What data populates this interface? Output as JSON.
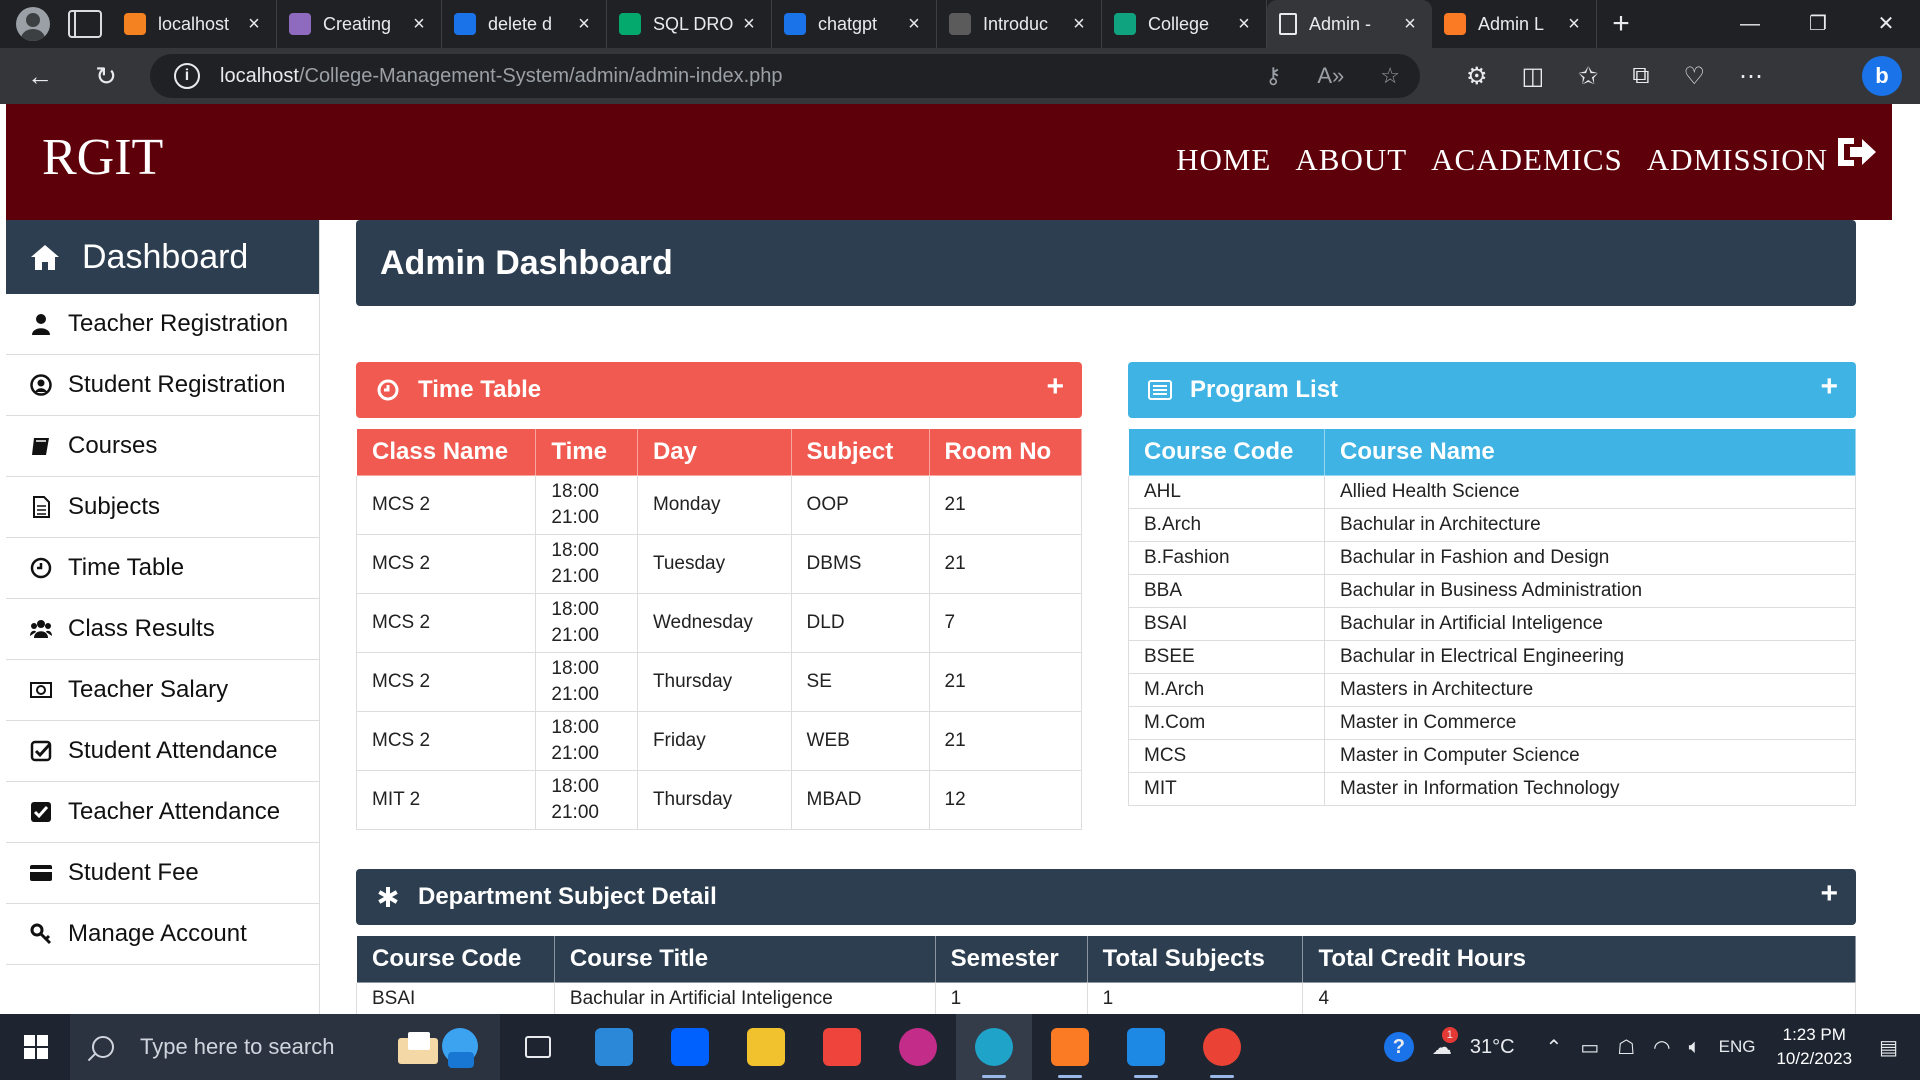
{
  "browser": {
    "tabs": [
      {
        "label": "localhost",
        "favicon": "xampp-icon",
        "color": "#f58220"
      },
      {
        "label": "Creating",
        "favicon": "avatar-icon",
        "color": "#8e6bbf"
      },
      {
        "label": "delete d",
        "favicon": "search-icon",
        "color": "#1a73e8"
      },
      {
        "label": "SQL DRO",
        "favicon": "w3schools-icon",
        "color": "#04aa6d"
      },
      {
        "label": "chatgpt",
        "favicon": "search-icon",
        "color": "#1a73e8"
      },
      {
        "label": "Introduc",
        "favicon": "openai-icon",
        "color": "#5b5b5b"
      },
      {
        "label": "College",
        "favicon": "openai-icon",
        "color": "#10a37f"
      },
      {
        "label": "Admin -",
        "favicon": "page-icon",
        "color": "#ffffff",
        "active": true
      },
      {
        "label": "Admin L",
        "favicon": "xampp-icon",
        "color": "#fb7a24"
      }
    ],
    "url_host": "localhost",
    "url_path": "/College-Management-System/admin/admin-index.php",
    "new_tab": "+",
    "window_controls": [
      "—",
      "❐",
      "✕"
    ],
    "bing_label": "b"
  },
  "site": {
    "logo": "RGIT",
    "nav": [
      "HOME",
      "ABOUT",
      "ACADEMICS",
      "ADMISSION"
    ],
    "brand_color": "#5e000a"
  },
  "sidebar": {
    "dashboard": "Dashboard",
    "items": [
      {
        "label": "Teacher Registration",
        "icon": "user-icon"
      },
      {
        "label": "Student Registration",
        "icon": "user-circle-icon"
      },
      {
        "label": "Courses",
        "icon": "book-icon"
      },
      {
        "label": "Subjects",
        "icon": "document-icon"
      },
      {
        "label": "Time Table",
        "icon": "clock-icon"
      },
      {
        "label": "Class Results",
        "icon": "users-icon"
      },
      {
        "label": "Teacher Salary",
        "icon": "money-icon"
      },
      {
        "label": "Student Attendance",
        "icon": "check-square-icon"
      },
      {
        "label": "Teacher Attendance",
        "icon": "check-square-filled-icon"
      },
      {
        "label": "Student Fee",
        "icon": "credit-card-icon"
      },
      {
        "label": "Manage Account",
        "icon": "key-icon"
      }
    ]
  },
  "main": {
    "title": "Admin Dashboard",
    "timetable": {
      "title": "Time Table",
      "color": "#f05a50",
      "headers": [
        "Class Name",
        "Time",
        "Day",
        "Subject",
        "Room No"
      ],
      "rows": [
        [
          "MCS 2",
          "18:00",
          "21:00",
          "Monday",
          "OOP",
          "21"
        ],
        [
          "MCS 2",
          "18:00",
          "21:00",
          "Tuesday",
          "DBMS",
          "21"
        ],
        [
          "MCS 2",
          "18:00",
          "21:00",
          "Wednesday",
          "DLD",
          "7"
        ],
        [
          "MCS 2",
          "18:00",
          "21:00",
          "Thursday",
          "SE",
          "21"
        ],
        [
          "MCS 2",
          "18:00",
          "21:00",
          "Friday",
          "WEB",
          "21"
        ],
        [
          "MIT 2",
          "18:00",
          "21:00",
          "Thursday",
          "MBAD",
          "12"
        ]
      ]
    },
    "programs": {
      "title": "Program List",
      "color": "#3fb3e3",
      "headers": [
        "Course Code",
        "Course Name"
      ],
      "rows": [
        [
          "AHL",
          "Allied Health Science"
        ],
        [
          "B.Arch",
          "Bachular in Architecture"
        ],
        [
          "B.Fashion",
          "Bachular in Fashion and Design"
        ],
        [
          "BBA",
          "Bachular in Business Administration"
        ],
        [
          "BSAI",
          "Bachular in Artificial Inteligence"
        ],
        [
          "BSEE",
          "Bachular in Electrical Engineering"
        ],
        [
          "M.Arch",
          "Masters in Architecture"
        ],
        [
          "M.Com",
          "Master in Commerce"
        ],
        [
          "MCS",
          "Master in Computer Science"
        ],
        [
          "MIT",
          "Master in Information Technology"
        ]
      ]
    },
    "department": {
      "title": "Department Subject Detail",
      "color": "#2c3e50",
      "headers": [
        "Course Code",
        "Course Title",
        "Semester",
        "Total Subjects",
        "Total Credit Hours"
      ],
      "rows": [
        [
          "BSAI",
          "Bachular in Artificial Inteligence",
          "1",
          "1",
          "4"
        ]
      ]
    },
    "add_label": "+"
  },
  "taskbar": {
    "search_placeholder": "Type here to search",
    "apps": [
      {
        "name": "task-view-icon",
        "color": "#1e2531"
      },
      {
        "name": "mail-icon",
        "color": "#2b88d8"
      },
      {
        "name": "dropbox-icon",
        "color": "#0061fe"
      },
      {
        "name": "file-explorer-icon",
        "color": "#f2c12e"
      },
      {
        "name": "anydesk-icon",
        "color": "#ef443b"
      },
      {
        "name": "wps-office-icon",
        "color": "#c42c8a"
      },
      {
        "name": "edge-icon",
        "color": "#1fa3c9"
      },
      {
        "name": "xampp-icon",
        "color": "#fb7a24"
      },
      {
        "name": "vscode-icon",
        "color": "#1e88e5"
      },
      {
        "name": "chrome-icon",
        "color": "#ea4335"
      }
    ],
    "temperature": "31°C",
    "weather_badge": "1",
    "language": "ENG",
    "time": "1:23 PM",
    "date": "10/2/2023"
  }
}
